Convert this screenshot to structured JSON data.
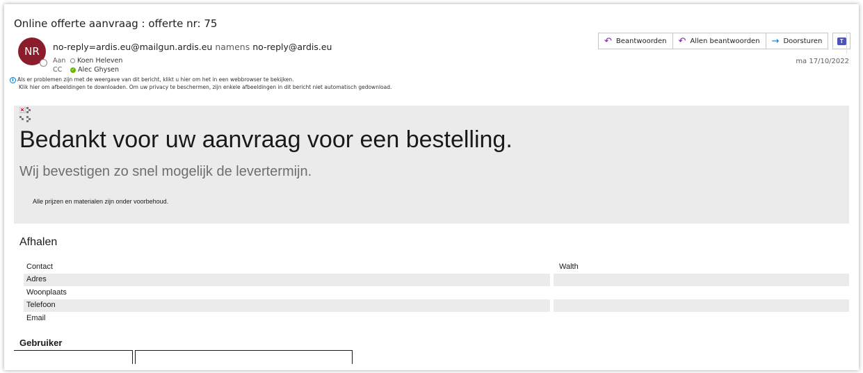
{
  "email": {
    "subject": "Online offerte aanvraag :  offerte nr:  75",
    "avatar_initials": "NR",
    "from_address": "no-reply=ardis.eu@mailgun.ardis.eu",
    "from_namens": "namens",
    "from_sender": "no-reply@ardis.eu",
    "to_label": "Aan",
    "to_name": "Koen Heleven",
    "cc_label": "CC",
    "cc_name": "Alec Ghysen",
    "info_line_1": "Als er problemen zijn met de weergave van dit bericht, klikt u hier om het in een webbrowser te bekijken.",
    "info_line_2": "Klik hier om afbeeldingen te downloaden. Om uw privacy te beschermen, zijn enkele afbeeldingen in dit bericht niet automatisch gedownload.",
    "date": "ma 17/10/2022"
  },
  "actions": {
    "reply": "Beantwoorden",
    "reply_all": "Allen beantwoorden",
    "forward": "Doorsturen",
    "reply_icon": "reply-icon",
    "reply_all_icon": "reply-all-icon",
    "forward_icon": "forward-arrow-icon",
    "teams_icon": "teams-icon"
  },
  "body": {
    "title": "Bedankt voor uw aanvraag voor een bestelling.",
    "subtitle": "Wij bevestigen zo snel mogelijk de levertermijn.",
    "note": "Alle prijzen en materialen zijn onder voorbehoud.",
    "section": "Afhalen",
    "fields": [
      {
        "label": "Contact",
        "value": "Walth"
      },
      {
        "label": "Adres",
        "value": ""
      },
      {
        "label": "Woonplaats",
        "value": ""
      },
      {
        "label": "Telefoon",
        "value": ""
      },
      {
        "label": "Email",
        "value": ""
      }
    ],
    "gebruiker": "Gebruiker"
  },
  "colors": {
    "avatar": "#8a1c2b",
    "accent_purple": "#7719aa",
    "accent_blue": "#0078d4",
    "banner": "#ebebeb"
  }
}
